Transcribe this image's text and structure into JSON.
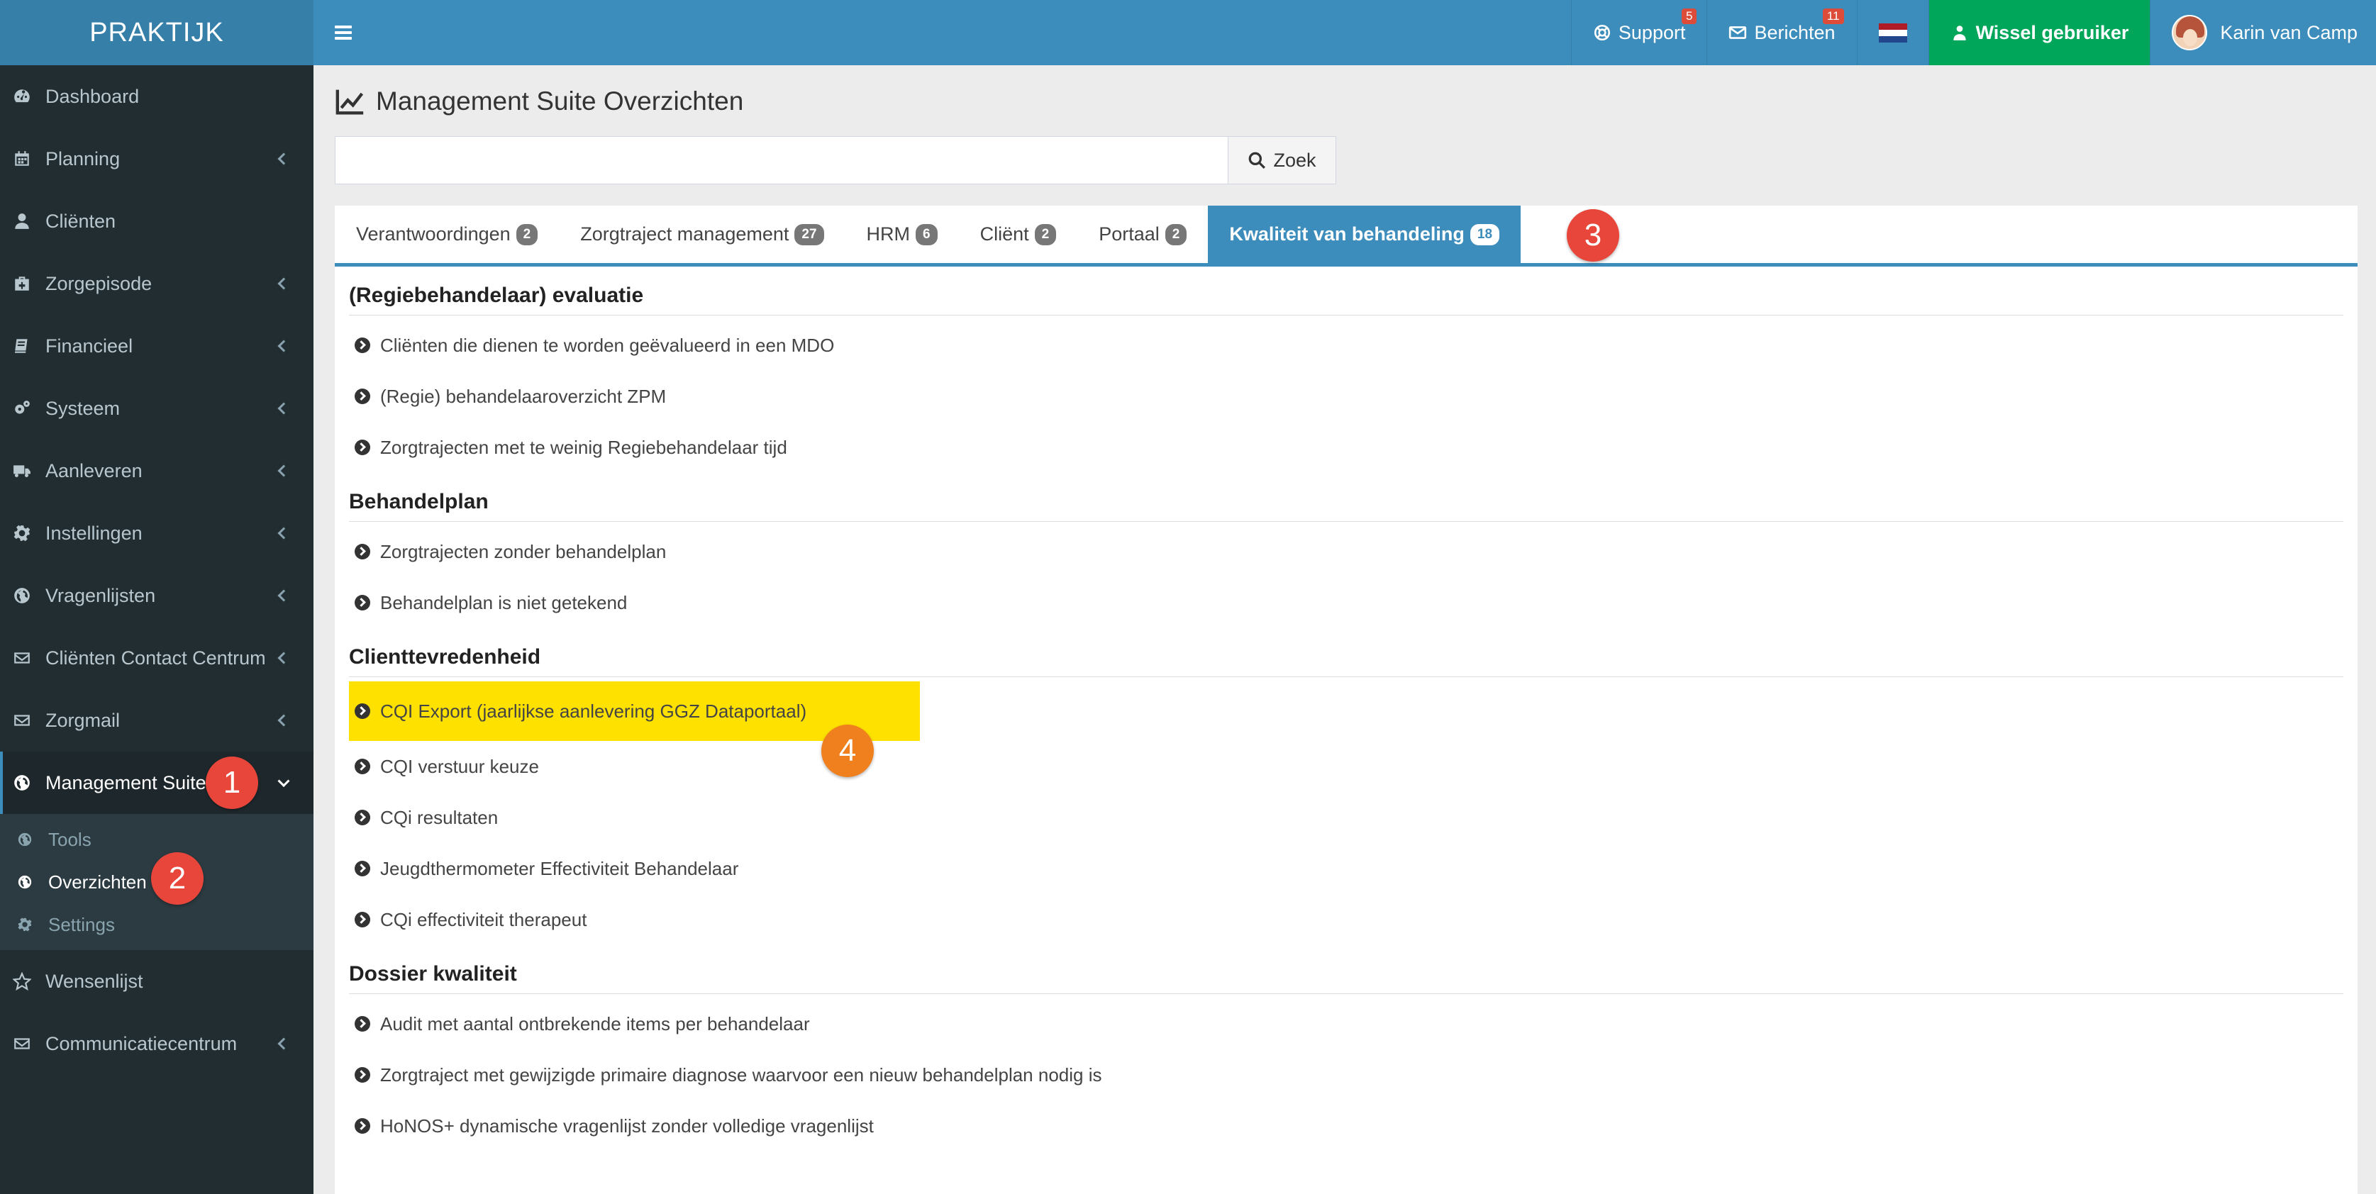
{
  "app": {
    "logo": "PRAKTIJK"
  },
  "sidebar": {
    "items": [
      {
        "label": "Dashboard",
        "icon": "dashboard-icon",
        "chevron": false
      },
      {
        "label": "Planning",
        "icon": "calendar-icon",
        "chevron": true
      },
      {
        "label": "Cliënten",
        "icon": "user-icon",
        "chevron": false
      },
      {
        "label": "Zorgepisode",
        "icon": "medkit-icon",
        "chevron": true
      },
      {
        "label": "Financieel",
        "icon": "book-icon",
        "chevron": true
      },
      {
        "label": "Systeem",
        "icon": "cogs-icon",
        "chevron": true
      },
      {
        "label": "Aanleveren",
        "icon": "truck-icon",
        "chevron": true
      },
      {
        "label": "Instellingen",
        "icon": "gear-icon",
        "chevron": true
      },
      {
        "label": "Vragenlijsten",
        "icon": "globe-icon",
        "chevron": true
      },
      {
        "label": "Cliënten Contact Centrum",
        "icon": "envelope-icon",
        "chevron": true
      },
      {
        "label": "Zorgmail",
        "icon": "envelope-icon",
        "chevron": true
      },
      {
        "label": "Management Suite",
        "icon": "globe-icon",
        "chevron": true,
        "active": true
      }
    ],
    "submenu": [
      {
        "label": "Tools",
        "icon": "globe-icon"
      },
      {
        "label": "Overzichten",
        "icon": "globe-icon",
        "active": true
      },
      {
        "label": "Settings",
        "icon": "gear-icon"
      }
    ],
    "items_after": [
      {
        "label": "Wensenlijst",
        "icon": "star-icon",
        "chevron": false
      },
      {
        "label": "Communicatiecentrum",
        "icon": "envelope-icon",
        "chevron": true
      }
    ]
  },
  "topbar": {
    "support_label": "Support",
    "support_count": "5",
    "berichten_label": "Berichten",
    "berichten_count": "11",
    "wissel_label": "Wissel gebruiker",
    "user_name": "Karin van Camp",
    "colors": {
      "bar": "#3c8dbc",
      "wissel": "#00a65a"
    }
  },
  "page": {
    "title": "Management Suite Overzichten",
    "search_value": "",
    "search_button": "Zoek"
  },
  "tabs": [
    {
      "label": "Verantwoordingen",
      "count": "2"
    },
    {
      "label": "Zorgtraject management",
      "count": "27"
    },
    {
      "label": "HRM",
      "count": "6"
    },
    {
      "label": "Cliënt",
      "count": "2"
    },
    {
      "label": "Portaal",
      "count": "2"
    },
    {
      "label": "Kwaliteit van behandeling",
      "count": "18",
      "active": true
    }
  ],
  "sections": [
    {
      "title": "(Regiebehandelaar) evaluatie",
      "items": [
        "Cliënten die dienen te worden geëvalueerd in een MDO",
        "(Regie) behandelaaroverzicht ZPM",
        "Zorgtrajecten met te weinig Regiebehandelaar tijd"
      ]
    },
    {
      "title": "Behandelplan",
      "items": [
        "Zorgtrajecten zonder behandelplan",
        "Behandelplan is niet getekend"
      ]
    },
    {
      "title": "Clienttevredenheid",
      "items": [
        "CQI Export (jaarlijkse aanlevering GGZ Dataportaal)",
        "CQI verstuur keuze",
        "CQi resultaten",
        "Jeugdthermometer Effectiviteit Behandelaar",
        "CQi effectiviteit therapeut"
      ]
    },
    {
      "title": "Dossier kwaliteit",
      "items": [
        "Audit met aantal ontbrekende items per behandelaar",
        "Zorgtraject met gewijzigde primaire diagnose waarvoor een nieuw behandelplan nodig is",
        "HoNOS+ dynamische vragenlijst zonder volledige vragenlijst"
      ]
    }
  ],
  "markers": [
    "1",
    "2",
    "3",
    "4"
  ],
  "highlight_color": "#ffe100"
}
